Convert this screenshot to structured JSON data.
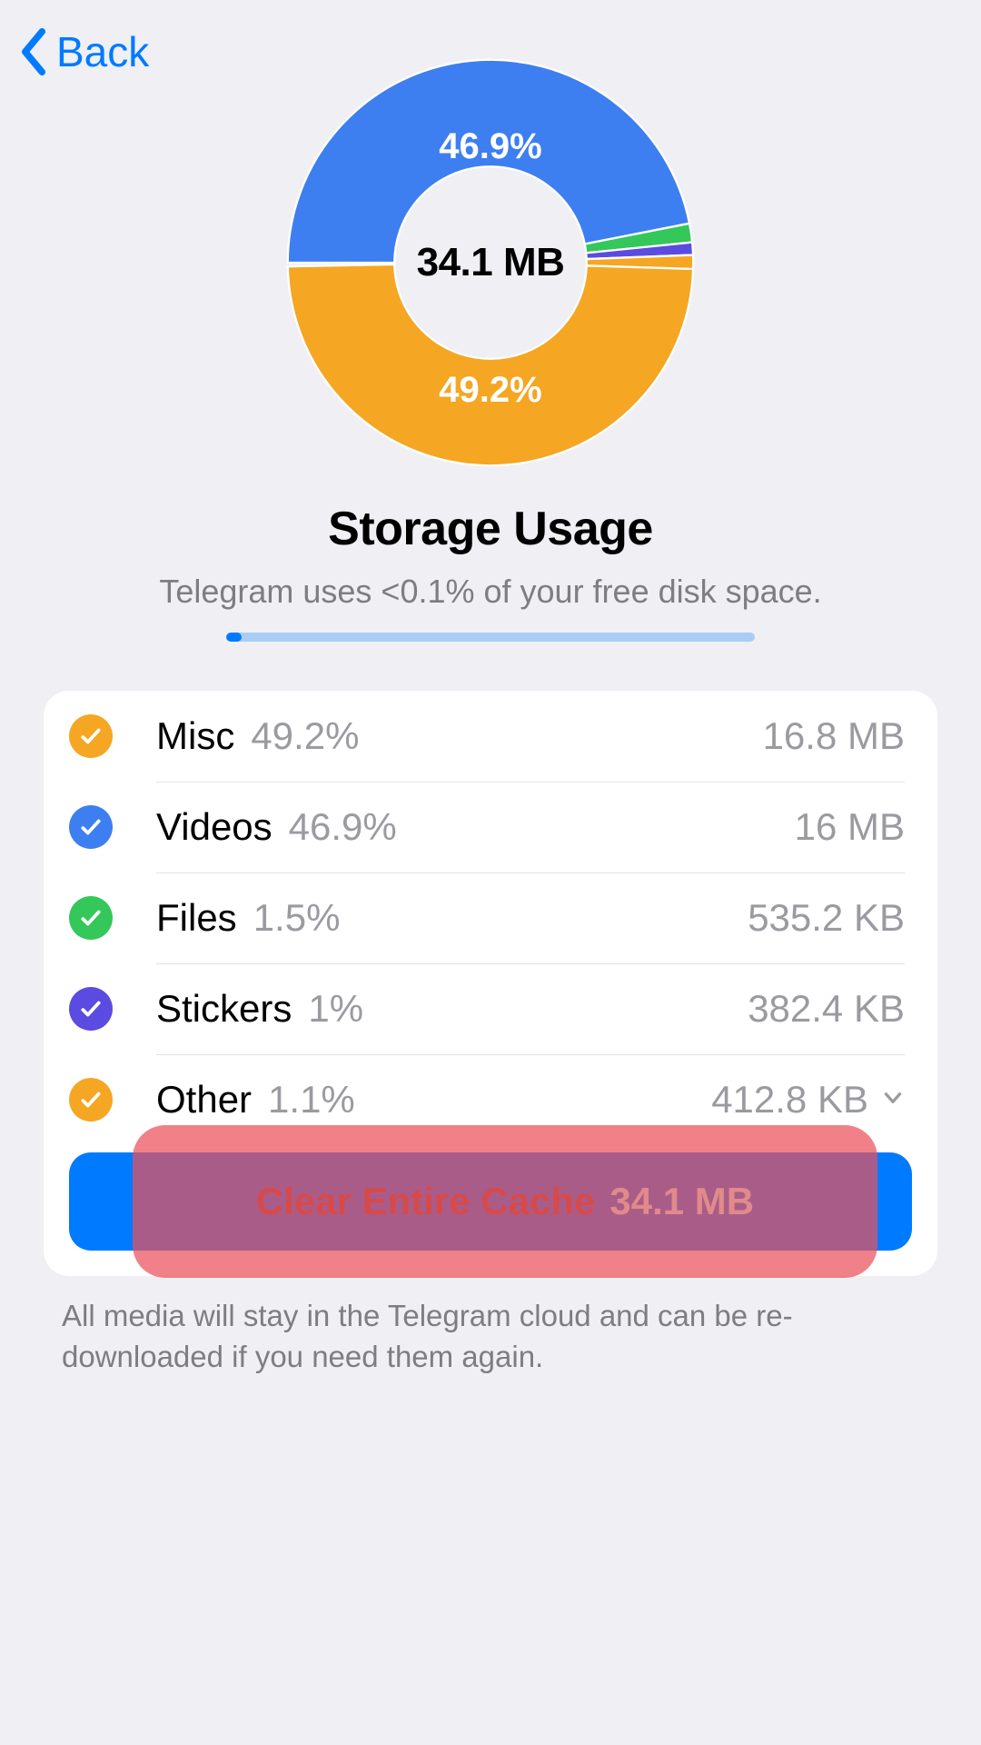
{
  "nav": {
    "back_label": "Back"
  },
  "chart": {
    "center_value": "34.1 MB",
    "top_label": "46.9%",
    "bottom_label": "49.2%"
  },
  "chart_data": {
    "type": "pie",
    "title": "Storage Usage",
    "center_value": 34.1,
    "center_unit": "MB",
    "series": [
      {
        "name": "Misc",
        "percent": 49.2,
        "size": "16.8 MB",
        "color": "#f5a623"
      },
      {
        "name": "Videos",
        "percent": 46.9,
        "size": "16 MB",
        "color": "#3d7ff0"
      },
      {
        "name": "Files",
        "percent": 1.5,
        "size": "535.2 KB",
        "color": "#34c759"
      },
      {
        "name": "Stickers",
        "percent": 1.0,
        "size": "382.4 KB",
        "color": "#5b4be0"
      },
      {
        "name": "Other",
        "percent": 1.1,
        "size": "412.8 KB",
        "color": "#f5a623"
      }
    ],
    "labeled_slices": [
      "Videos",
      "Misc"
    ]
  },
  "title": "Storage Usage",
  "subtitle": "Telegram uses <0.1% of your free disk space.",
  "categories": [
    {
      "name": "Misc",
      "percent": "49.2%",
      "size": "16.8 MB",
      "color": "#f5a623",
      "expandable": false
    },
    {
      "name": "Videos",
      "percent": "46.9%",
      "size": "16 MB",
      "color": "#3d7ff0",
      "expandable": false
    },
    {
      "name": "Files",
      "percent": "1.5%",
      "size": "535.2 KB",
      "color": "#34c759",
      "expandable": false
    },
    {
      "name": "Stickers",
      "percent": "1%",
      "size": "382.4 KB",
      "color": "#5b4be0",
      "expandable": false
    },
    {
      "name": "Other",
      "percent": "1.1%",
      "size": "412.8 KB",
      "color": "#f5a623",
      "expandable": true
    }
  ],
  "clear_button": {
    "label": "Clear Entire Cache",
    "size": "34.1 MB"
  },
  "footer": "All media will stay in the Telegram cloud and can be re-downloaded if you need them again."
}
